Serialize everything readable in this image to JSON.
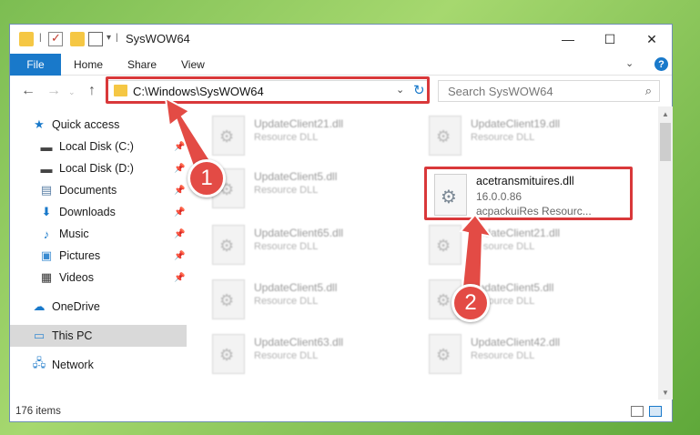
{
  "window": {
    "title": "SysWOW64",
    "minimize": "—",
    "maximize": "☐",
    "close": "✕"
  },
  "ribbon": {
    "tabs": [
      "File",
      "Home",
      "Share",
      "View"
    ],
    "help": "?"
  },
  "nav": {
    "address": "C:\\Windows\\SysWOW64",
    "search_placeholder": "Search SysWOW64"
  },
  "sidebar": {
    "items": [
      {
        "label": "Quick access",
        "icon": "star-icon"
      },
      {
        "label": "Local Disk (C:)",
        "icon": "drive-icon",
        "pinned": true
      },
      {
        "label": "Local Disk (D:)",
        "icon": "drive-icon",
        "pinned": true
      },
      {
        "label": "Documents",
        "icon": "document-icon",
        "pinned": true
      },
      {
        "label": "Downloads",
        "icon": "download-icon",
        "pinned": true
      },
      {
        "label": "Music",
        "icon": "music-icon",
        "pinned": true
      },
      {
        "label": "Pictures",
        "icon": "pictures-icon",
        "pinned": true
      },
      {
        "label": "Videos",
        "icon": "video-icon",
        "pinned": true
      },
      {
        "label": "OneDrive",
        "icon": "cloud-icon"
      },
      {
        "label": "This PC",
        "icon": "computer-icon",
        "selected": true
      },
      {
        "label": "Network",
        "icon": "network-icon"
      }
    ]
  },
  "files": {
    "left": [
      {
        "name": "UpdateClient21.dll",
        "type": "Resource DLL"
      },
      {
        "name": "UpdateClient5.dll",
        "type": "Resource DLL"
      },
      {
        "name": "UpdateClient65.dll",
        "type": "Resource DLL"
      },
      {
        "name": "UpdateClient5.dll",
        "type": "Resource DLL"
      },
      {
        "name": "UpdateClient63.dll",
        "type": "Resource DLL"
      }
    ],
    "right": [
      {
        "name": "UpdateClient19.dll",
        "type": "Resource DLL"
      },
      {
        "name": "UpdateClient21.dll",
        "type": "Resource DLL"
      },
      {
        "name": "UpdateClient5.dll",
        "type": "Resource DLL"
      },
      {
        "name": "UpdateClient42.dll",
        "type": "Resource DLL"
      }
    ],
    "highlighted": {
      "name": "acetransmituires.dll",
      "version": "16.0.0.86",
      "description": "acpackuiRes Resourc..."
    }
  },
  "status": {
    "count": "176 items"
  },
  "annotations": {
    "badge1": "1",
    "badge2": "2",
    "color": "#d9383a"
  },
  "colors": {
    "accent": "#1979ca"
  }
}
